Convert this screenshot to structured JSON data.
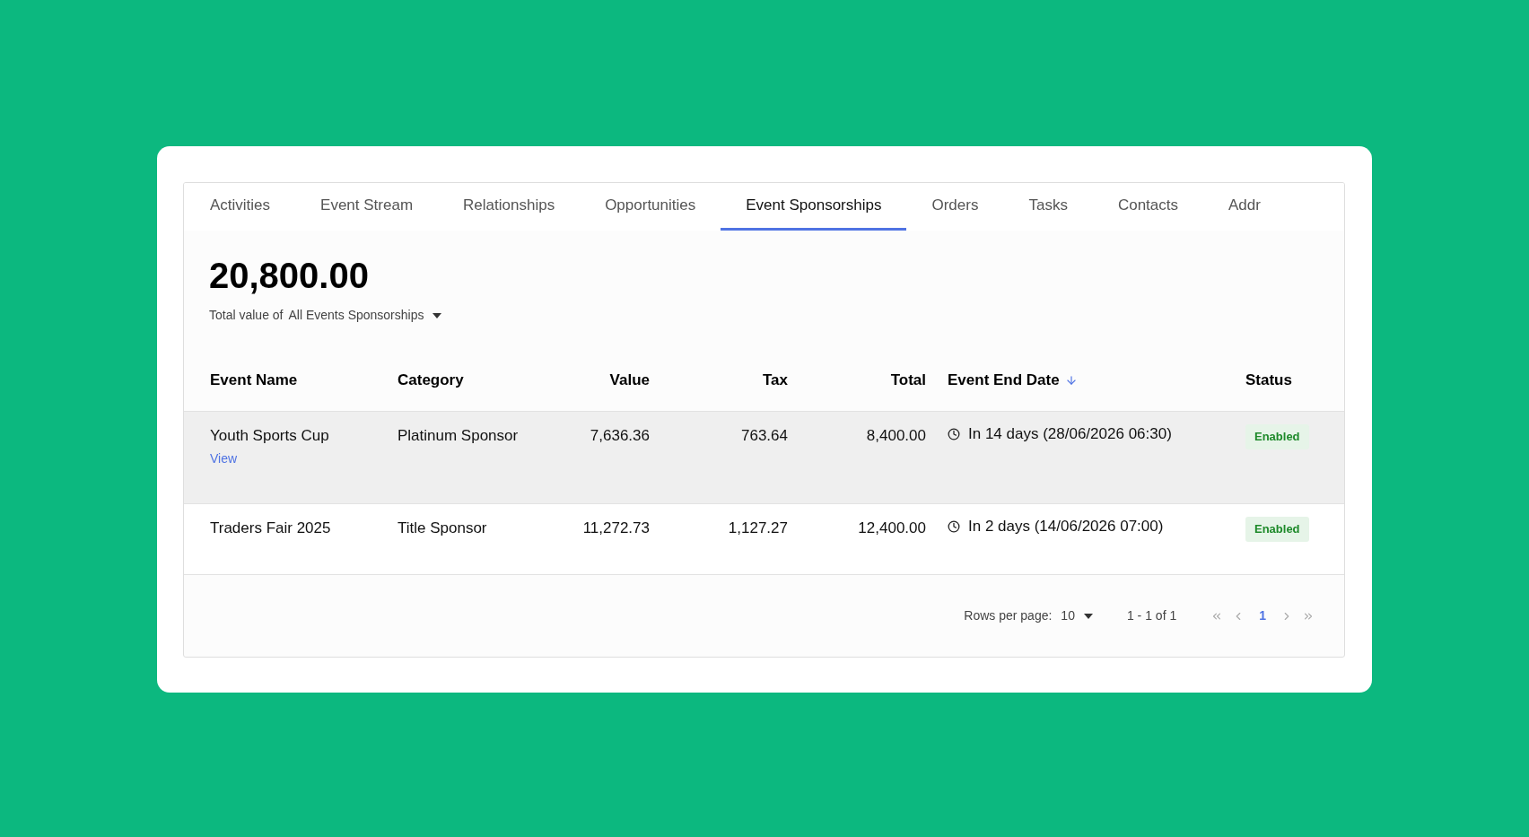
{
  "tabs": [
    {
      "label": "Activities",
      "selected": false
    },
    {
      "label": "Event Stream",
      "selected": false
    },
    {
      "label": "Relationships",
      "selected": false
    },
    {
      "label": "Opportunities",
      "selected": false
    },
    {
      "label": "Event Sponsorships",
      "selected": true
    },
    {
      "label": "Orders",
      "selected": false
    },
    {
      "label": "Tasks",
      "selected": false
    },
    {
      "label": "Contacts",
      "selected": false
    },
    {
      "label": "Addr",
      "selected": false
    }
  ],
  "summary": {
    "total": "20,800.00",
    "caption": "Total value of",
    "filter": "All Events Sponsorships"
  },
  "table": {
    "columns": [
      {
        "label": "Event Name",
        "sorted": false
      },
      {
        "label": "Category",
        "sorted": false
      },
      {
        "label": "Value",
        "sorted": false
      },
      {
        "label": "Tax",
        "sorted": false
      },
      {
        "label": "Total",
        "sorted": false
      },
      {
        "label": "Event End Date",
        "sorted": true
      },
      {
        "label": "Status",
        "sorted": false
      }
    ],
    "rows": [
      {
        "highlighted": true,
        "name": "Youth Sports Cup",
        "link": "View",
        "category": "Platinum Sponsor",
        "value": "7,636.36",
        "tax": "763.64",
        "total": "8,400.00",
        "end_date": "In 14 days (28/06/2026 06:30)",
        "status": "Enabled"
      },
      {
        "highlighted": false,
        "name": "Traders Fair 2025",
        "category": "Title Sponsor",
        "value": "11,272.73",
        "tax": "1,127.27",
        "total": "12,400.00",
        "end_date": "In 2 days (14/06/2026 07:00)",
        "status": "Enabled"
      }
    ]
  },
  "pagination": {
    "rows_per_page_label": "Rows per page:",
    "rows_per_page": "10",
    "range": "1 - 1 of 1",
    "pages": [
      {
        "label": "1",
        "selected": true
      }
    ]
  }
}
